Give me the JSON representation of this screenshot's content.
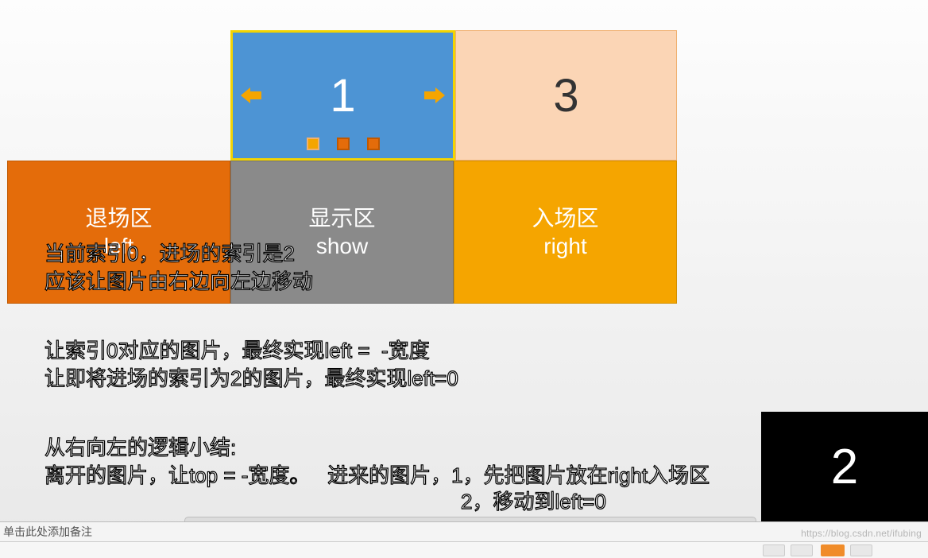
{
  "carousel": {
    "visible_slot_number": "1",
    "incoming_slot_number": "3",
    "offscreen_slot_number": "2",
    "dots": [
      {
        "active": true
      },
      {
        "active": false
      },
      {
        "active": false
      }
    ]
  },
  "zones": {
    "left": {
      "title": "退场区",
      "sub": "left"
    },
    "show": {
      "title": "显示区",
      "sub": "show"
    },
    "right": {
      "title": "入场区",
      "sub": "right"
    }
  },
  "overlay": {
    "block1": "当前索引0，进场的索引是2\n应该让图片由右边向左边移动",
    "block2": "让索引0对应的图片，最终实现left =  -宽度\n让即将进场的索引为2的图片，最终实现left=0",
    "block3": "从右向左的逻辑小结:\n离开的图片，让top = -宽度。   进来的图片，1，先把图片放在right入场区",
    "block3_cont": "2，移动到left=0"
  },
  "notes_placeholder": "单击此处添加备注",
  "watermark": "https://blog.csdn.net/ifubing"
}
